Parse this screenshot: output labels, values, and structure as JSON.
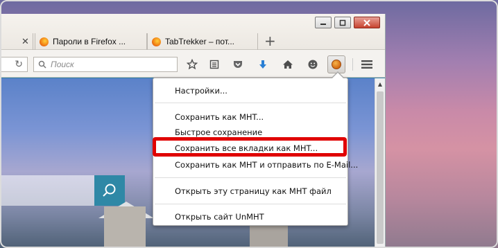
{
  "tabs": [
    {
      "title": "Пароли в Firefox ..."
    },
    {
      "title": "TabTrekker – пот..."
    }
  ],
  "toolbar": {
    "search_placeholder": "Поиск"
  },
  "menu": {
    "items": [
      {
        "label": "Настройки..."
      },
      {
        "label": "Сохранить как MHT..."
      },
      {
        "label": "Быстрое сохранение"
      },
      {
        "label": "Сохранить все вкладки как MHT..."
      },
      {
        "label": "Сохранить как MHT и отправить по E-Mail..."
      },
      {
        "label": "Открыть эту страницу как MHT файл"
      },
      {
        "label": "Открыть сайт UnMHT"
      }
    ],
    "highlighted_index": 3
  },
  "colors": {
    "highlight": "#e00000",
    "download_arrow": "#2a7fd4",
    "pocket": "#666666"
  },
  "icons": [
    "minimize-icon",
    "maximize-icon",
    "close-icon",
    "firefox-icon",
    "reload-icon",
    "search-icon",
    "bookmark-star-icon",
    "reading-list-icon",
    "pocket-icon",
    "download-icon",
    "home-icon",
    "smiley-icon",
    "unmht-icon",
    "hamburger-menu-icon"
  ]
}
